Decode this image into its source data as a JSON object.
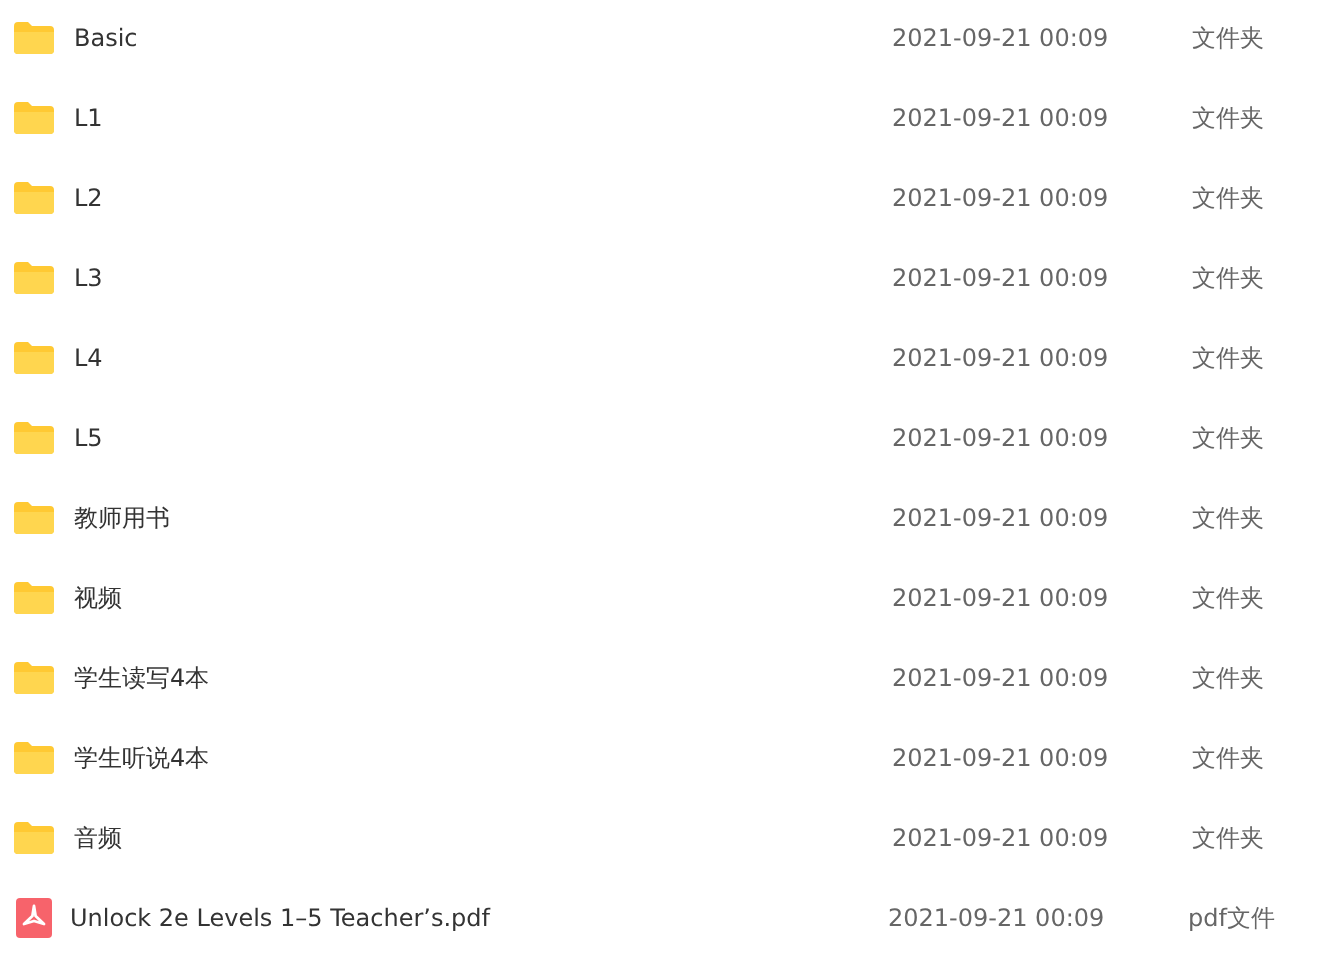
{
  "files": [
    {
      "kind": "folder",
      "name": "Basic",
      "modified": "2021-09-21 00:09",
      "type": "文件夹"
    },
    {
      "kind": "folder",
      "name": "L1",
      "modified": "2021-09-21 00:09",
      "type": "文件夹"
    },
    {
      "kind": "folder",
      "name": "L2",
      "modified": "2021-09-21 00:09",
      "type": "文件夹"
    },
    {
      "kind": "folder",
      "name": "L3",
      "modified": "2021-09-21 00:09",
      "type": "文件夹"
    },
    {
      "kind": "folder",
      "name": "L4",
      "modified": "2021-09-21 00:09",
      "type": "文件夹"
    },
    {
      "kind": "folder",
      "name": "L5",
      "modified": "2021-09-21 00:09",
      "type": "文件夹"
    },
    {
      "kind": "folder",
      "name": "教师用书",
      "modified": "2021-09-21 00:09",
      "type": "文件夹"
    },
    {
      "kind": "folder",
      "name": "视频",
      "modified": "2021-09-21 00:09",
      "type": "文件夹"
    },
    {
      "kind": "folder",
      "name": "学生读写4本",
      "modified": "2021-09-21 00:09",
      "type": "文件夹"
    },
    {
      "kind": "folder",
      "name": "学生听说4本",
      "modified": "2021-09-21 00:09",
      "type": "文件夹"
    },
    {
      "kind": "folder",
      "name": "音频",
      "modified": "2021-09-21 00:09",
      "type": "文件夹"
    },
    {
      "kind": "pdf",
      "name": "Unlock 2e Levels 1–5 Teacher’s.pdf",
      "modified": "2021-09-21 00:09",
      "type": "pdf文件"
    }
  ]
}
